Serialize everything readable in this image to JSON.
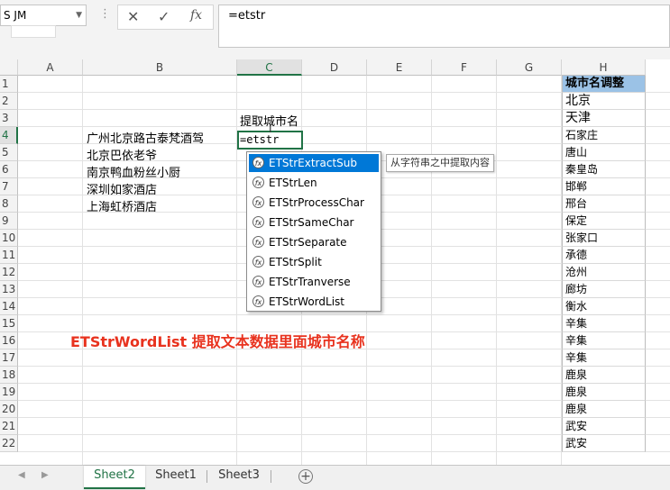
{
  "namebox": {
    "value": "S JM"
  },
  "formula_bar": {
    "cancel_icon": "✕",
    "enter_icon": "✓",
    "fx_icon": "fx",
    "content": "=etstr"
  },
  "columns": [
    "A",
    "B",
    "C",
    "D",
    "E",
    "F",
    "G",
    "H"
  ],
  "rows": [
    "1",
    "2",
    "3",
    "4",
    "5",
    "6",
    "7",
    "8",
    "9",
    "10",
    "11",
    "12",
    "13",
    "14",
    "15",
    "16",
    "17",
    "18",
    "19",
    "20",
    "21",
    "22"
  ],
  "cells": {
    "c3": "提取城市名",
    "b4": "广州北京路古泰梵酒驾",
    "b5": "北京巴依老爷",
    "b6": "南京鸭血粉丝小厨",
    "b7": "深圳如家酒店",
    "b8": "上海虹桥酒店",
    "c4": "=etstr"
  },
  "h_column": [
    "城市名调整",
    "北京",
    "天津",
    "石家庄",
    "唐山",
    "秦皇岛",
    "邯郸",
    "邢台",
    "保定",
    "张家口",
    "承德",
    "沧州",
    "廊坊",
    "衡水",
    "辛集",
    "辛集",
    "辛集",
    "鹿泉",
    "鹿泉",
    "鹿泉",
    "武安",
    "武安"
  ],
  "autocomplete": {
    "items": [
      "ETStrExtractSub",
      "ETStrLen",
      "ETStrProcessChar",
      "ETStrSameChar",
      "ETStrSeparate",
      "ETStrSplit",
      "ETStrTranverse",
      "ETStrWordList"
    ],
    "selected_index": 0,
    "tooltip": "从字符串之中提取内容"
  },
  "banner": "ETStrWordList 提取文本数据里面城市名称",
  "sheets": [
    "Sheet2",
    "Sheet1",
    "Sheet3"
  ],
  "active_sheet": "Sheet2",
  "colors": {
    "accent": "#217346",
    "header_fill": "#9bc2e6",
    "banner": "#e8321e",
    "selection": "#0078d7"
  }
}
